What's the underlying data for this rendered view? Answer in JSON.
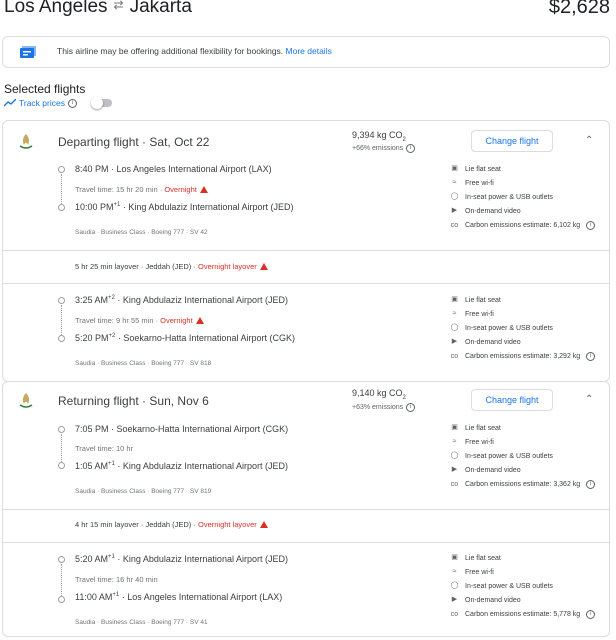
{
  "header": {
    "origin": "Los Angeles",
    "destination": "Jakarta",
    "arrow": "⇄",
    "price": "$2,628"
  },
  "banner": {
    "text": "This airline may be offering additional flexibility for bookings.",
    "link": "More details"
  },
  "selected": {
    "title": "Selected flights",
    "track_label": "Track prices"
  },
  "departing": {
    "title": "Departing flight",
    "date": "Sat, Oct 22",
    "co2": "9,394 kg CO",
    "co2_sub": "2",
    "co2_delta": "+66% emissions",
    "change_label": "Change flight",
    "seg1": {
      "dep_time": "8:40 PM",
      "dep_airport": "Los Angeles International Airport (LAX)",
      "travel": "Travel time: 15 hr 20 min",
      "overnight": "Overnight",
      "arr_time": "10:00 PM",
      "arr_plus": "+1",
      "arr_airport": "King Abdulaziz International Airport (JED)",
      "meta": "Saudia · Business Class · Boeing 777 · SV 42",
      "amenities": [
        "Lie flat seat",
        "Free wi-fi",
        "In-seat power & USB outlets",
        "On-demand video",
        "Carbon emissions estimate: 6,102 kg"
      ]
    },
    "layover": "5 hr 25 min layover · Jeddah (JED)",
    "layover_overnight": "Overnight layover",
    "seg2": {
      "dep_time": "3:25 AM",
      "dep_plus": "+2",
      "dep_airport": "King Abdulaziz International Airport (JED)",
      "travel": "Travel time: 9 hr 55 min",
      "overnight": "Overnight",
      "arr_time": "5:20 PM",
      "arr_plus": "+2",
      "arr_airport": "Soekarno-Hatta International Airport (CGK)",
      "meta": "Saudia · Business Class · Boeing 777 · SV 818",
      "amenities": [
        "Lie flat seat",
        "Free wi-fi",
        "In-seat power & USB outlets",
        "On-demand video",
        "Carbon emissions estimate: 3,292 kg"
      ]
    }
  },
  "returning": {
    "title": "Returning flight",
    "date": "Sun, Nov 6",
    "co2": "9,140 kg CO",
    "co2_sub": "2",
    "co2_delta": "+63% emissions",
    "change_label": "Change flight",
    "seg1": {
      "dep_time": "7:05 PM",
      "dep_airport": "Soekarno-Hatta International Airport (CGK)",
      "travel": "Travel time: 10 hr",
      "arr_time": "1:05 AM",
      "arr_plus": "+1",
      "arr_airport": "King Abdulaziz International Airport (JED)",
      "meta": "Saudia · Business Class · Boeing 777 · SV 819",
      "amenities": [
        "Lie flat seat",
        "Free wi-fi",
        "In-seat power & USB outlets",
        "On-demand video",
        "Carbon emissions estimate: 3,362 kg"
      ]
    },
    "layover": "4 hr 15 min layover · Jeddah (JED)",
    "layover_overnight": "Overnight layover",
    "seg2": {
      "dep_time": "5:20 AM",
      "dep_plus": "+1",
      "dep_airport": "King Abdulaziz International Airport (JED)",
      "travel": "Travel time: 16 hr 40 min",
      "arr_time": "11:00 AM",
      "arr_plus": "+1",
      "arr_airport": "Los Angeles International Airport (LAX)",
      "meta": "Saudia · Business Class · Boeing 777 · SV 41",
      "amenities": [
        "Lie flat seat",
        "Free wi-fi",
        "In-seat power & USB outlets",
        "On-demand video",
        "Carbon emissions estimate: 5,778 kg"
      ]
    }
  }
}
